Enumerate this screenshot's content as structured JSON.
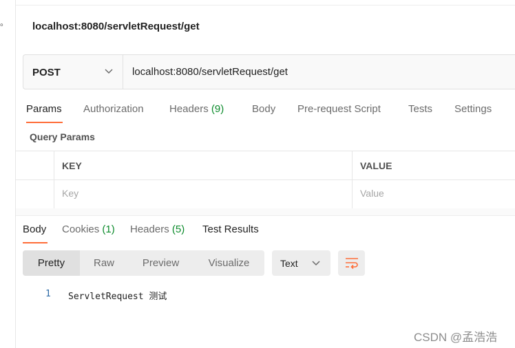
{
  "request_title": "localhost:8080/servletRequest/get",
  "request": {
    "method": "POST",
    "url": "localhost:8080/servletRequest/get"
  },
  "request_tabs": [
    {
      "label": "Params",
      "count": ""
    },
    {
      "label": "Authorization",
      "count": ""
    },
    {
      "label": "Headers",
      "count": "(9)"
    },
    {
      "label": "Body",
      "count": ""
    },
    {
      "label": "Pre-request Script",
      "count": ""
    },
    {
      "label": "Tests",
      "count": ""
    },
    {
      "label": "Settings",
      "count": ""
    }
  ],
  "query_params": {
    "label": "Query Params",
    "col_key": "KEY",
    "col_value": "VALUE",
    "key_placeholder": "Key",
    "value_placeholder": "Value"
  },
  "response_tabs": [
    {
      "label": "Body",
      "count": ""
    },
    {
      "label": "Cookies",
      "count": "(1)"
    },
    {
      "label": "Headers",
      "count": "(5)"
    },
    {
      "label": "Test Results",
      "count": ""
    }
  ],
  "view_modes": [
    "Pretty",
    "Raw",
    "Preview",
    "Visualize"
  ],
  "format": "Text",
  "response_body": {
    "line_number": "1",
    "text": "ServletRequest 测试"
  },
  "left_strip_char": "。",
  "watermark": "CSDN @孟浩浩",
  "colors": {
    "accent": "#ff6c37",
    "count": "#0a8a2a",
    "wrap_icon": "#ff6c37"
  },
  "icons": [
    "chevron-down-icon",
    "wrap-lines-icon"
  ]
}
